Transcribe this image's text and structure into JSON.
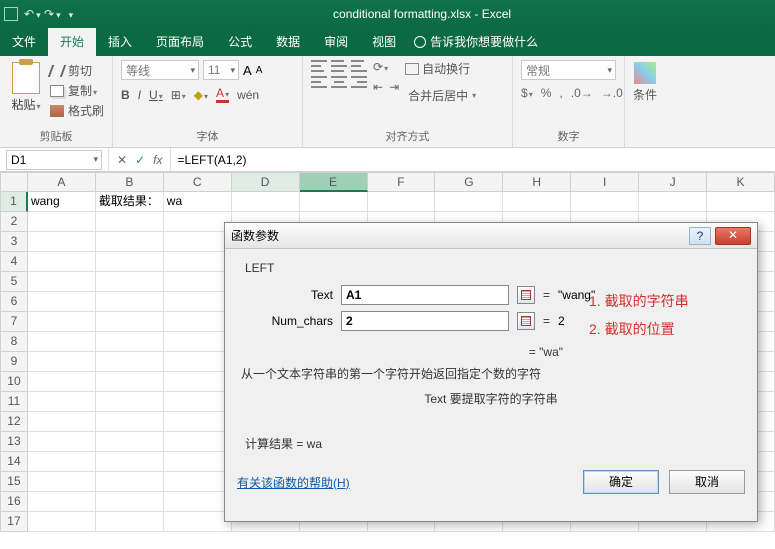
{
  "window": {
    "title": "conditional formatting.xlsx - Excel"
  },
  "tabs": {
    "file": "文件",
    "home": "开始",
    "insert": "插入",
    "layout": "页面布局",
    "formulas": "公式",
    "data": "数据",
    "review": "审阅",
    "view": "视图",
    "tell": "告诉我你想要做什么"
  },
  "ribbon": {
    "clipboard": {
      "paste": "粘贴",
      "cut": "剪切",
      "copy": "复制",
      "brush": "格式刷",
      "label": "剪贴板"
    },
    "font": {
      "family": "等线",
      "size": "11",
      "grow": "A",
      "shrink": "A",
      "bold": "B",
      "italic": "I",
      "underline": "U",
      "label": "字体"
    },
    "align": {
      "wrap": "自动换行",
      "merge": "合并后居中",
      "label": "对齐方式"
    },
    "number": {
      "format": "常规",
      "label": "数字"
    },
    "cf": {
      "label": "条件"
    }
  },
  "namebox": "D1",
  "formula_bar": {
    "cancel": "✕",
    "ok": "✓",
    "fx": "fx",
    "value": "=LEFT(A1,2)"
  },
  "cols": [
    "A",
    "B",
    "C",
    "D",
    "E",
    "F",
    "G",
    "H",
    "I",
    "J",
    "K"
  ],
  "rowNums": [
    "1",
    "2",
    "3",
    "4",
    "5",
    "6",
    "7",
    "8",
    "9",
    "10",
    "11",
    "12",
    "13",
    "14",
    "15",
    "16",
    "17"
  ],
  "cells": {
    "A1": "wang",
    "B1": "截取结果：",
    "C1": "wa"
  },
  "dialog": {
    "title": "函数参数",
    "fn": "LEFT",
    "arg1": {
      "label": "Text",
      "value": "A1",
      "result": "\"wang\""
    },
    "arg2": {
      "label": "Num_chars",
      "value": "2",
      "result": "2"
    },
    "eq": "=",
    "anno1": "1. 截取的字符串",
    "anno2": "2. 截取的位置",
    "result_line": "=  \"wa\"",
    "desc": "从一个文本字符串的第一个字符开始返回指定个数的字符",
    "argdesc": "Text  要提取字符的字符串",
    "calc": "计算结果 =  wa",
    "help": "有关该函数的帮助(H)",
    "ok": "确定",
    "cancel": "取消",
    "helpIcon": "?",
    "closeIcon": "✕"
  }
}
